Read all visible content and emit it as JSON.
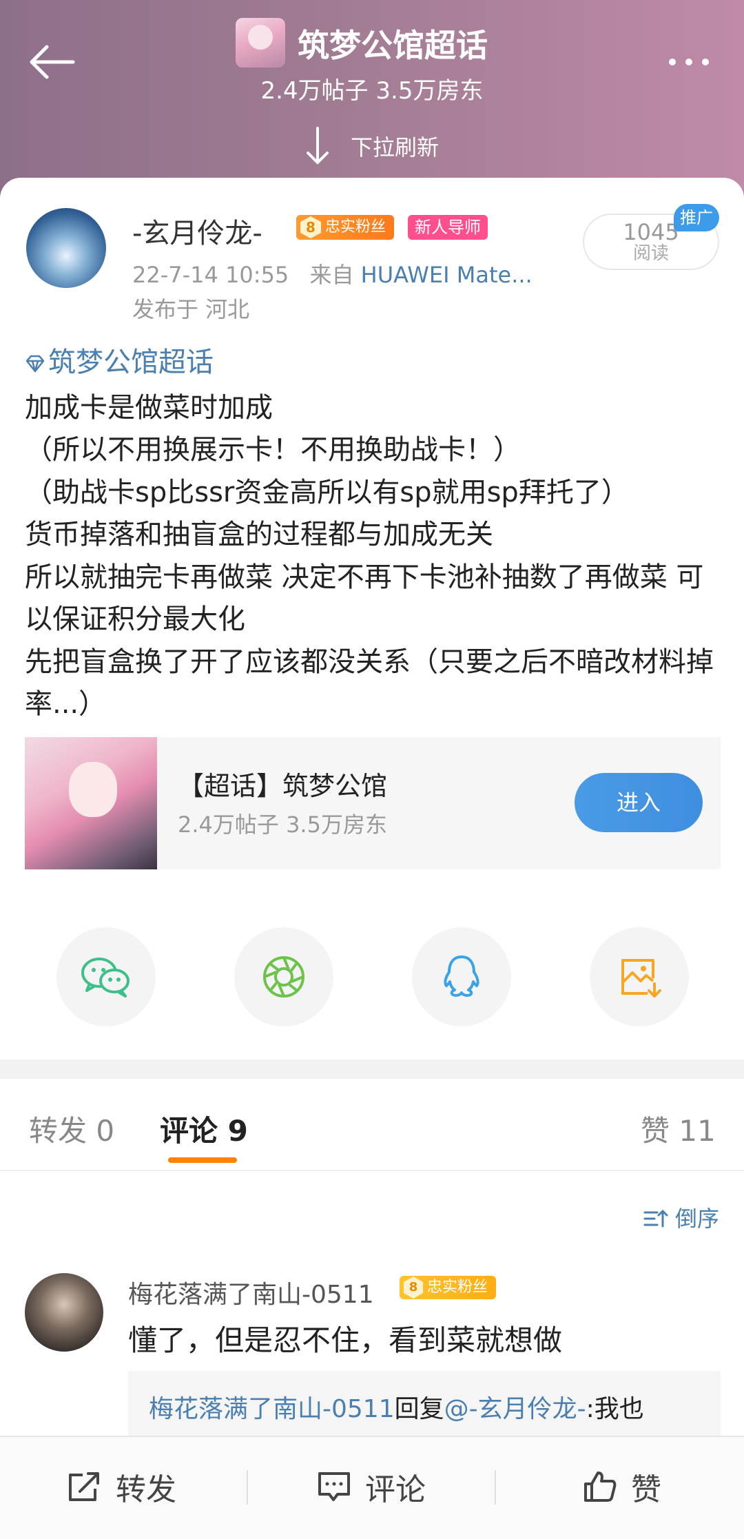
{
  "header": {
    "topic_title": "筑梦公馆超话",
    "topic_stats": "2.4万帖子 3.5万房东",
    "refresh_hint": "下拉刷新"
  },
  "post": {
    "username": "-玄月伶龙-",
    "fan_level": "8",
    "fan_badge": "忠实粉丝",
    "mentor_badge": "新人导师",
    "time": "22-7-14 10:55",
    "from_label": "来自",
    "device": "HUAWEI Mate...",
    "location": "发布于 河北",
    "read_count": "1045",
    "read_label": "阅读",
    "promo_tag": "推广",
    "topic_link": "筑梦公馆超话",
    "lines": [
      "加成卡是做菜时加成",
      "（所以不用换展示卡！不用换助战卡！）",
      "（助战卡sp比ssr资金高所以有sp就用sp拜托了）",
      "货币掉落和抽盲盒的过程都与加成无关",
      "所以就抽完卡再做菜 决定不再下卡池补抽数了再做菜 可以保证积分最大化",
      "先把盲盒换了开了应该都没关系（只要之后不暗改材料掉率...）"
    ]
  },
  "super_topic_card": {
    "name": "【超话】筑梦公馆",
    "stats": "2.4万帖子 3.5万房东",
    "enter_label": "进入"
  },
  "share": {
    "icons": [
      "wechat-icon",
      "moments-icon",
      "qq-icon",
      "save-image-icon"
    ],
    "colors": {
      "wechat": "#3cc08a",
      "moments": "#6cc24a",
      "qq": "#3aa3e8",
      "save": "#f5a623"
    }
  },
  "tabs": {
    "repost": "转发 0",
    "comment": "评论 9",
    "like": "赞 11",
    "sort": "倒序"
  },
  "comment": {
    "username": "梅花落满了南山-0511",
    "badge_level": "8",
    "badge": "忠实粉丝",
    "text": "懂了，但是忍不住，看到菜就想做",
    "reply_user": "梅花落满了南山-0511",
    "reply_word": "回复",
    "reply_target": "@-玄月伶龙-",
    "reply_text": ":我也"
  },
  "bottom_bar": {
    "repost": "转发",
    "comment": "评论",
    "like": "赞"
  },
  "colors": {
    "accent_orange": "#ff8200",
    "link_blue": "#4a7fb0",
    "enter_blue": "#4a9be6"
  }
}
